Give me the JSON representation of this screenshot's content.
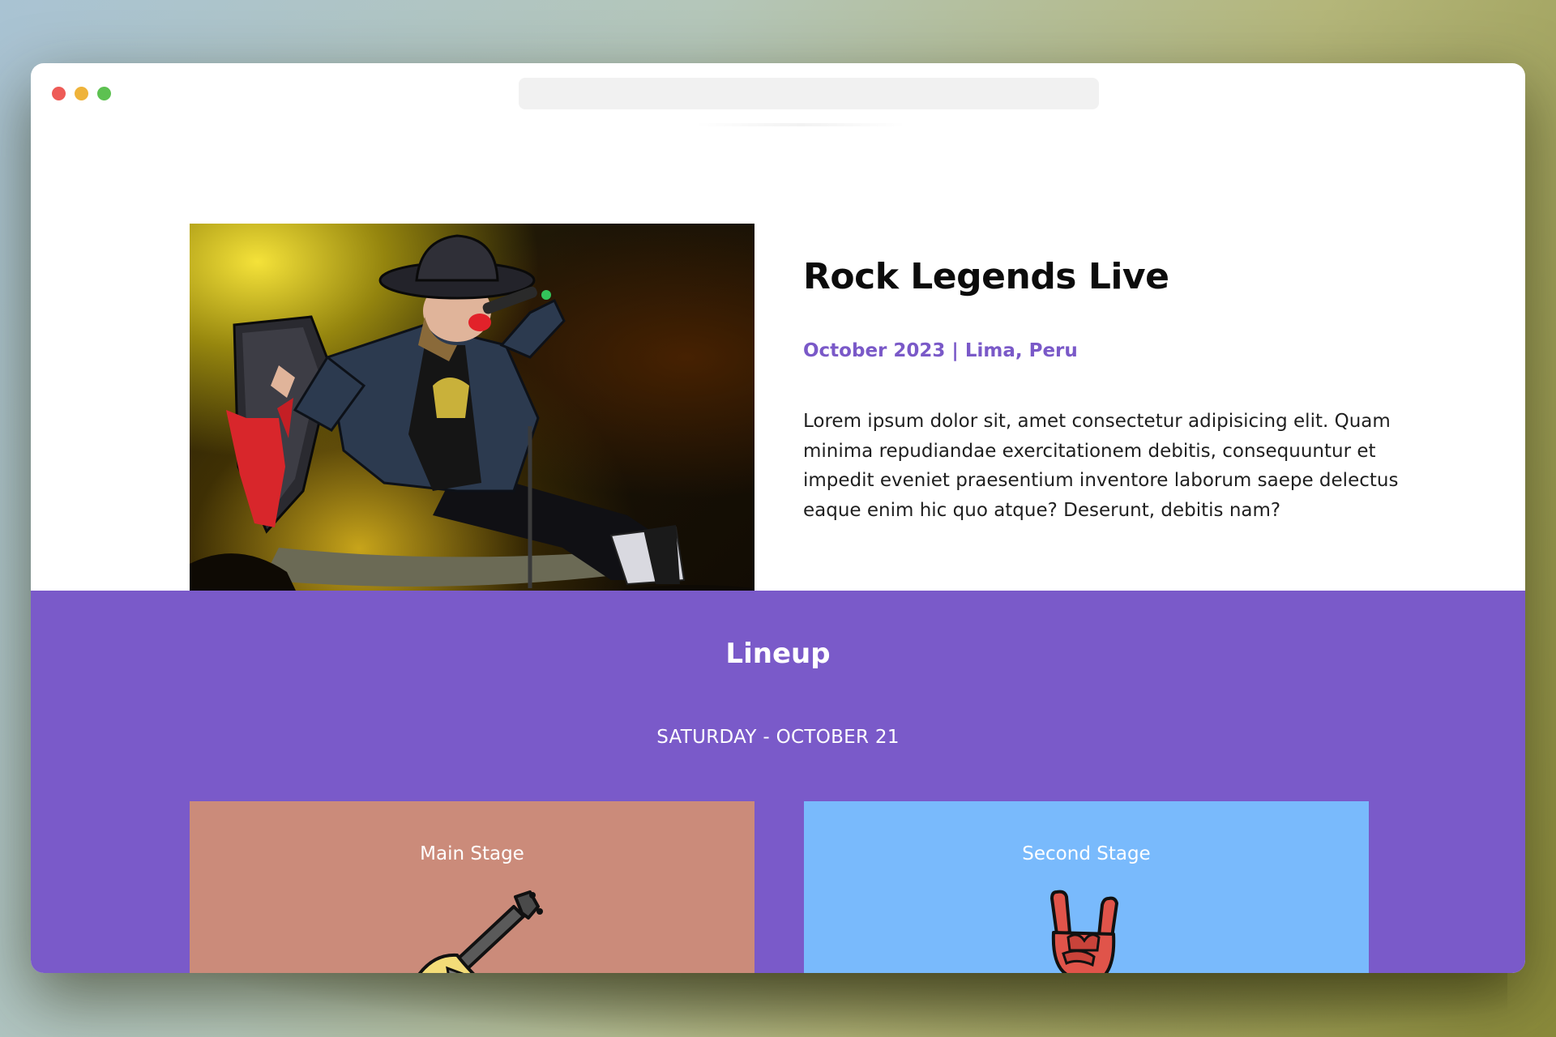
{
  "window": {
    "controls": [
      "close",
      "minimize",
      "maximize"
    ],
    "address_bar": ""
  },
  "hero": {
    "image_alt": "Singer in black hat performing on a throne on stage",
    "title": "Rock Legends Live",
    "subtitle": "October 2023 | Lima, Peru",
    "description": "Lorem ipsum dolor sit, amet consectetur adipisicing elit. Quam minima repudiandae exercitationem debitis, consequuntur et impedit eveniet praesentium inventore laborum saepe delectus eaque enim hic quo atque? Deserunt, debitis nam?"
  },
  "lineup": {
    "title": "Lineup",
    "date": "SATURDAY - OCTOBER 21",
    "stages": [
      {
        "label": "Main Stage",
        "icon": "guitar-icon",
        "color": "#cb8b7a"
      },
      {
        "label": "Second Stage",
        "icon": "rock-hand-icon",
        "color": "#79bafc"
      }
    ]
  },
  "colors": {
    "accent": "#7a59c8",
    "lineup_bg": "#7a5ac9"
  }
}
